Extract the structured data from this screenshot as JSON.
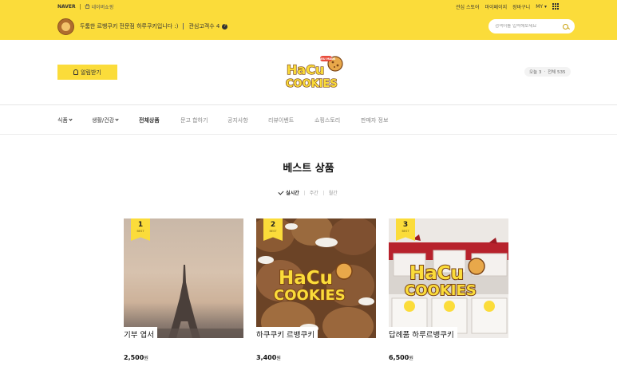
{
  "topbar": {
    "naver_label": "NAVER",
    "store_link_label": "네이버쇼핑",
    "links": [
      "관심 스토어",
      "마이페이지",
      "장바구니",
      "MY"
    ]
  },
  "store": {
    "description": "두툼한 르뱅쿠키 전문점 하루쿠키입니다 :)",
    "fav_label": "관심고객수 4",
    "help_mark": "?"
  },
  "search": {
    "placeholder": "검색어를 입력해보세요"
  },
  "header": {
    "notify_label": "알림받기",
    "visitors_today_label": "오늘 3",
    "visitors_total_label": "전체 535"
  },
  "logo": {
    "small_text": "HARU MADE",
    "line1": "HaCu",
    "line2": "COOKIES"
  },
  "nav": {
    "items": [
      {
        "label": "식품"
      },
      {
        "label": "생활/건강"
      },
      {
        "label": "전체상품"
      },
      {
        "label": "문고 합하기"
      },
      {
        "label": "공지사항"
      },
      {
        "label": "리뷰이벤트"
      },
      {
        "label": "쇼핑스토리"
      },
      {
        "label": "판매자 정보"
      }
    ]
  },
  "best": {
    "title": "베스트 상품",
    "tabs": [
      "실시간",
      "주간",
      "월간"
    ]
  },
  "products": [
    {
      "rank": "1",
      "badge": "BEST",
      "name": "기부 엽서",
      "price": "2,500",
      "unit": "원"
    },
    {
      "rank": "2",
      "badge": "BEST",
      "name": "하쿠쿠키 르뱅쿠키",
      "price": "3,400",
      "unit": "원"
    },
    {
      "rank": "3",
      "badge": "BEST",
      "name": "답례품 하루르뱅쿠키",
      "price": "6,500",
      "unit": "원"
    }
  ],
  "colors": {
    "brand_yellow": "#fbdc3a",
    "logo_brown": "#7a4416"
  }
}
